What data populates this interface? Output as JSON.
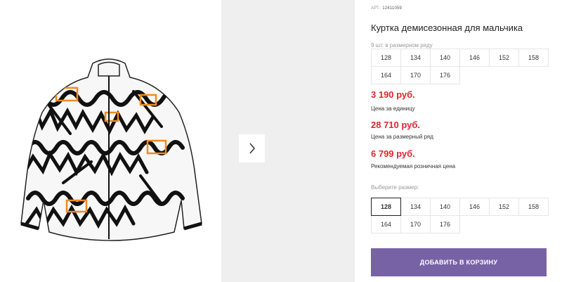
{
  "product": {
    "article_label": "АРТ.",
    "article_number": "12411059",
    "title": "Куртка демисезонная для мальчика"
  },
  "size_row_info": "9 шт. в размерном ряду",
  "size_row": [
    "128",
    "134",
    "140",
    "146",
    "152",
    "158",
    "164",
    "170",
    "176"
  ],
  "prices": {
    "unit_price": "3 190 руб.",
    "unit_price_label": "Цена за единицу",
    "row_price": "28 710 руб.",
    "row_price_label": "Цена за размерный ряд",
    "retail_price": "6 799 руб.",
    "retail_price_label": "Рекомендуемая розничная цена",
    "price_color": "#e4242f"
  },
  "size_select": {
    "label": "Выберите размер:",
    "options": [
      "128",
      "134",
      "140",
      "146",
      "152",
      "158",
      "164",
      "170",
      "176"
    ],
    "selected": "128"
  },
  "cart": {
    "add_label": "ДОБАВИТЬ В КОРЗИНУ",
    "button_color": "#7762a6"
  },
  "gallery": {
    "next_icon": "chevron-right-icon",
    "image_subject": "jacket-image"
  }
}
